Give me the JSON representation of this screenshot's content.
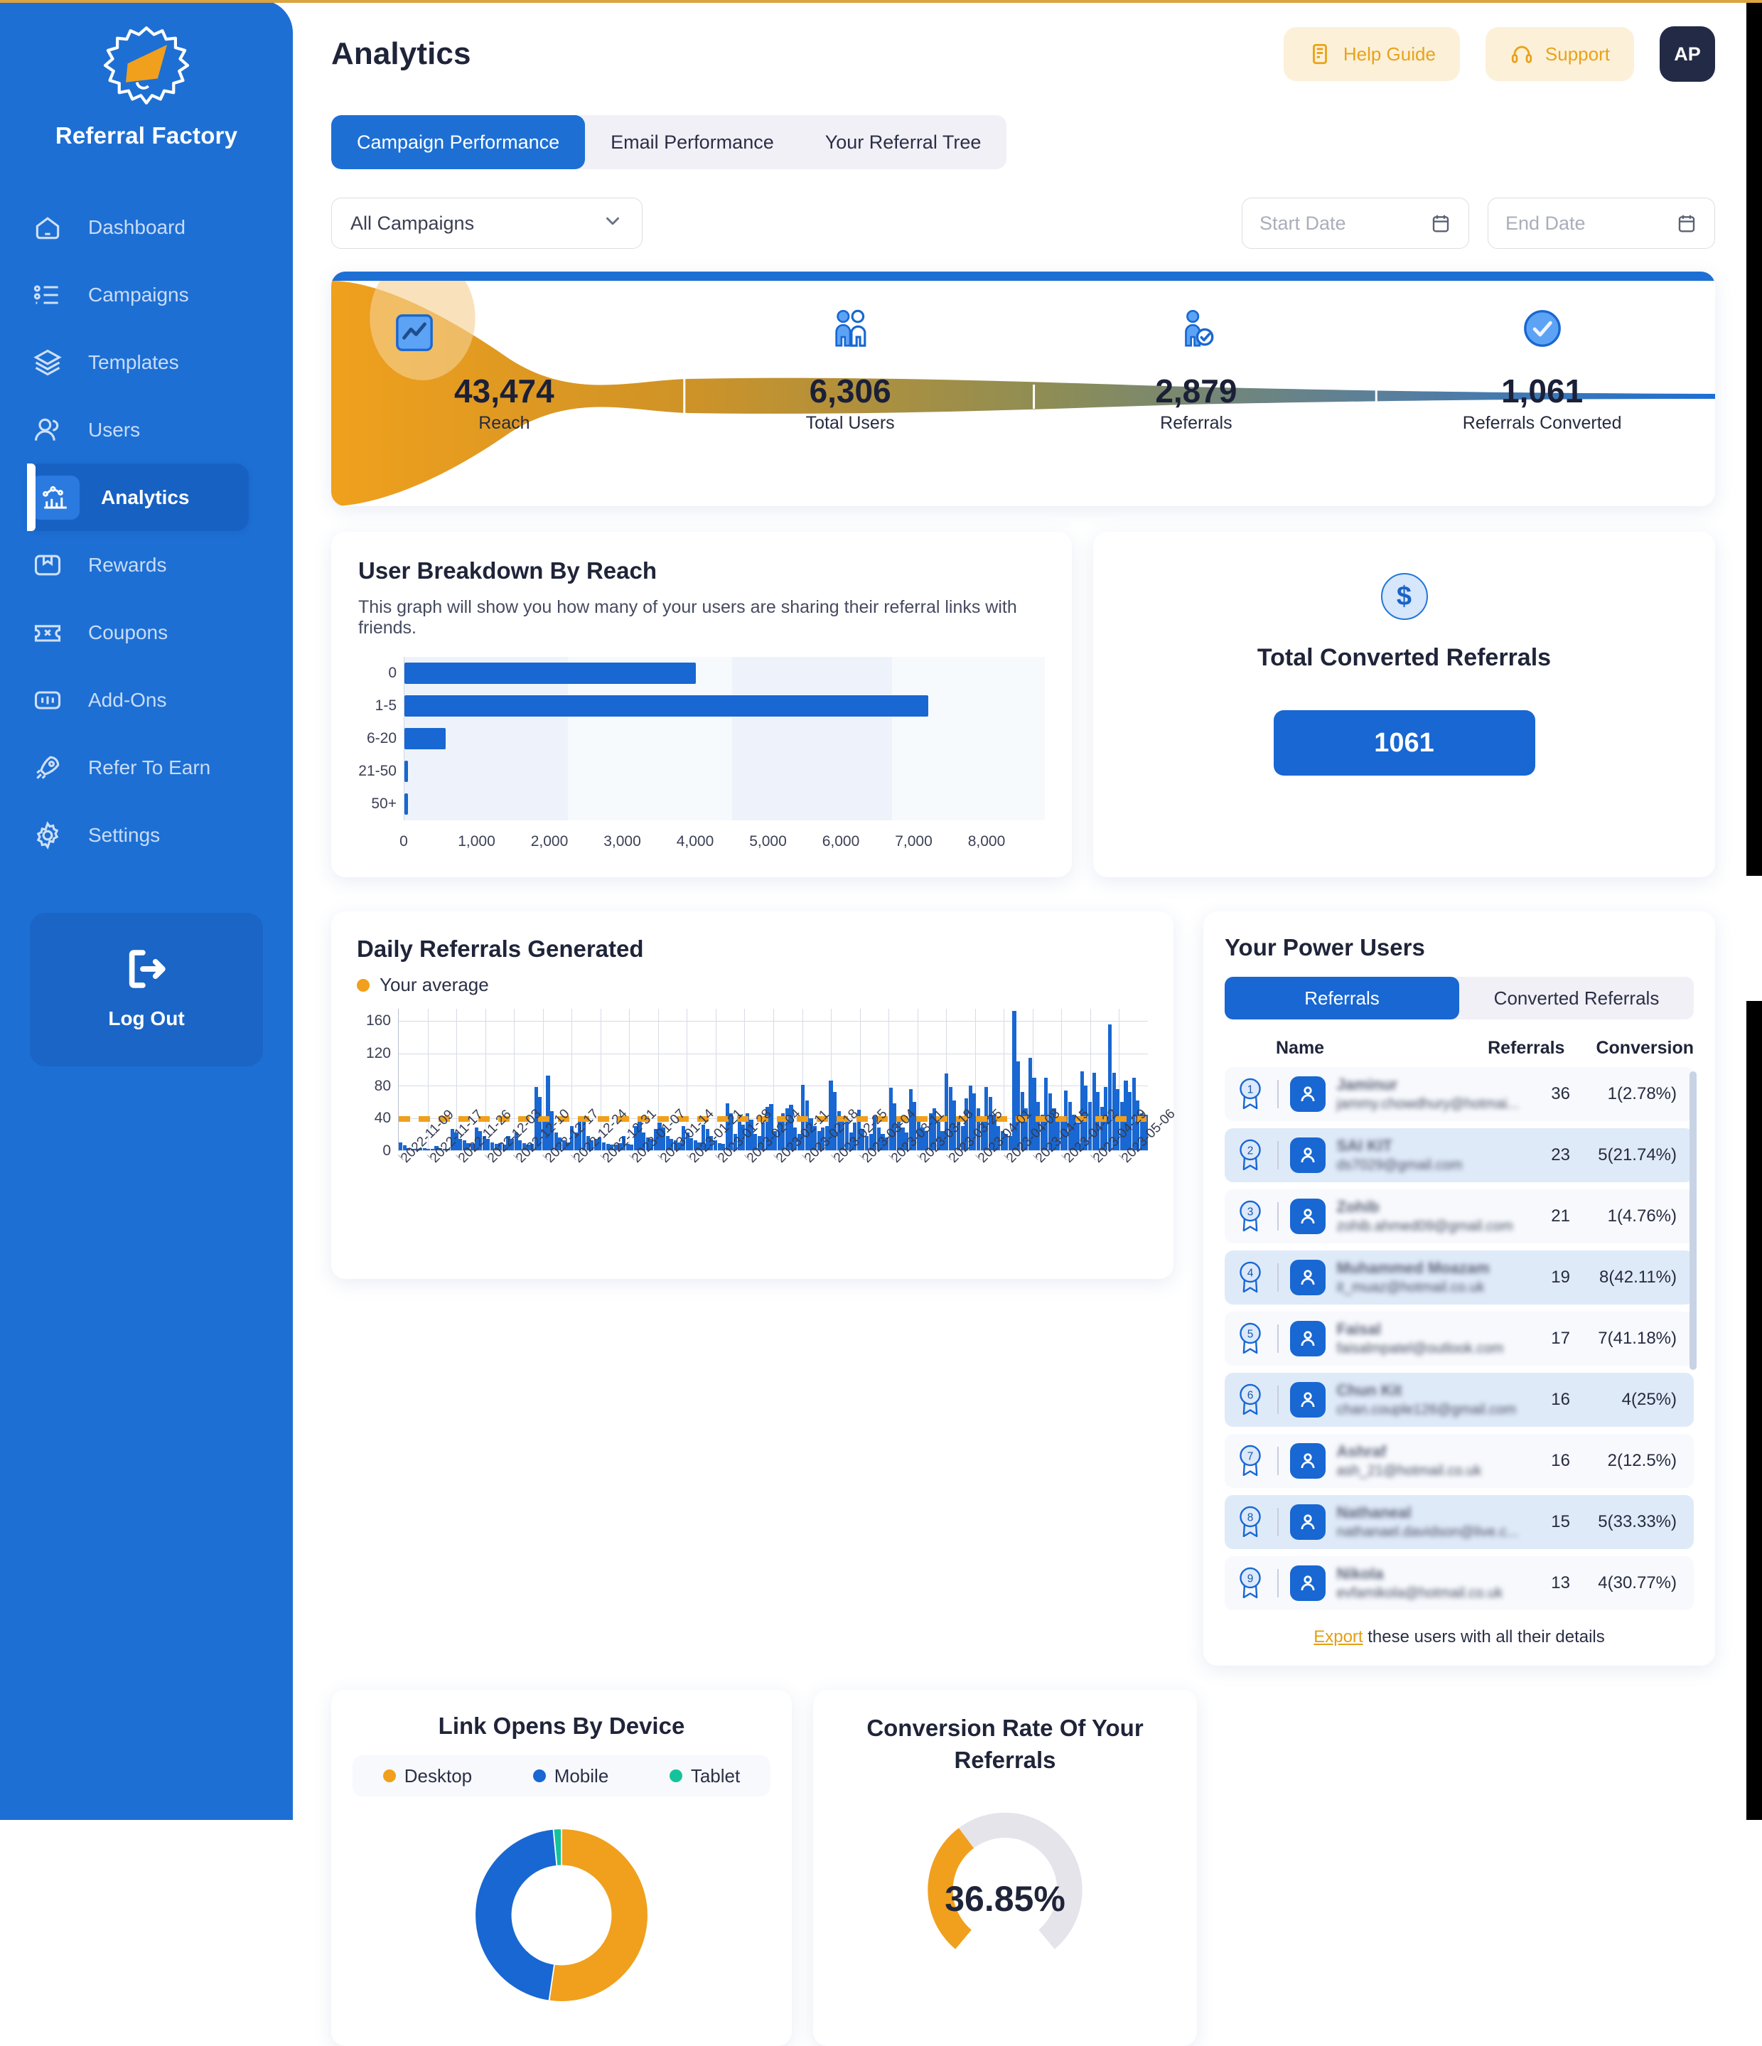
{
  "brand": {
    "name": "Referral Factory"
  },
  "sidebar": {
    "items": [
      {
        "label": "Dashboard",
        "icon": "home-icon",
        "active": false
      },
      {
        "label": "Campaigns",
        "icon": "list-icon",
        "active": false
      },
      {
        "label": "Templates",
        "icon": "layers-icon",
        "active": false
      },
      {
        "label": "Users",
        "icon": "users-icon",
        "active": false
      },
      {
        "label": "Analytics",
        "icon": "analytics-icon",
        "active": true
      },
      {
        "label": "Rewards",
        "icon": "gift-icon",
        "active": false
      },
      {
        "label": "Coupons",
        "icon": "ticket-icon",
        "active": false
      },
      {
        "label": "Add-Ons",
        "icon": "addons-icon",
        "active": false
      },
      {
        "label": "Refer To Earn",
        "icon": "rocket-icon",
        "active": false
      },
      {
        "label": "Settings",
        "icon": "gear-icon",
        "active": false
      }
    ],
    "logout_label": "Log Out"
  },
  "header": {
    "title": "Analytics",
    "help_label": "Help Guide",
    "support_label": "Support",
    "avatar_initials": "AP"
  },
  "tabs": [
    {
      "label": "Campaign Performance",
      "active": true
    },
    {
      "label": "Email Performance",
      "active": false
    },
    {
      "label": "Your Referral Tree",
      "active": false
    }
  ],
  "filters": {
    "campaign_selected": "All Campaigns",
    "start_date_placeholder": "Start Date",
    "end_date_placeholder": "End Date"
  },
  "funnel": {
    "steps": [
      {
        "value": "43,474",
        "label": "Reach",
        "icon": "chart-square-icon"
      },
      {
        "value": "6,306",
        "label": "Total Users",
        "icon": "two-people-icon"
      },
      {
        "value": "2,879",
        "label": "Referrals",
        "icon": "person-check-icon"
      },
      {
        "value": "1,061",
        "label": "Referrals Converted",
        "icon": "check-circle-icon"
      }
    ]
  },
  "breakdown": {
    "title": "User Breakdown By Reach",
    "subtitle": "This graph will show you how many of your users are sharing their referral links with friends."
  },
  "converted": {
    "title": "Total Converted Referrals",
    "value": "1061",
    "icon": "dollar-circle-icon"
  },
  "daily": {
    "title": "Daily Referrals Generated",
    "legend_label": "Your average"
  },
  "power_users": {
    "title": "Your Power Users",
    "tabs": [
      {
        "label": "Referrals",
        "active": true
      },
      {
        "label": "Converted Referrals",
        "active": false
      }
    ],
    "columns": {
      "name": "Name",
      "referrals": "Referrals",
      "conversion": "Conversion"
    },
    "rows": [
      {
        "rank": "1",
        "name": "Jaminur",
        "email": "jammy.chowdhury@hotmai...",
        "referrals": "36",
        "conversion": "1(2.78%)"
      },
      {
        "rank": "2",
        "name": "SAI KIT",
        "email": "ds7029@gmail.com",
        "referrals": "23",
        "conversion": "5(21.74%)"
      },
      {
        "rank": "3",
        "name": "Zohib",
        "email": "zohib.ahmed09@gmail.com",
        "referrals": "21",
        "conversion": "1(4.76%)"
      },
      {
        "rank": "4",
        "name": "Muhammed Moazam",
        "email": "it_muaz@hotmail.co.uk",
        "referrals": "19",
        "conversion": "8(42.11%)"
      },
      {
        "rank": "5",
        "name": "Faisal",
        "email": "faisalmpatel@outlook.com",
        "referrals": "17",
        "conversion": "7(41.18%)"
      },
      {
        "rank": "6",
        "name": "Chun Kit",
        "email": "chan.couple126@gmail.com",
        "referrals": "16",
        "conversion": "4(25%)"
      },
      {
        "rank": "7",
        "name": "Ashraf",
        "email": "ash_21@hotmail.co.uk",
        "referrals": "16",
        "conversion": "2(12.5%)"
      },
      {
        "rank": "8",
        "name": "Nathaneal",
        "email": "nathanael.davidson@live.c...",
        "referrals": "15",
        "conversion": "5(33.33%)"
      },
      {
        "rank": "9",
        "name": "Nikola",
        "email": "evfamikola@hotmail.co.uk",
        "referrals": "13",
        "conversion": "4(30.77%)"
      }
    ],
    "export_link": "Export",
    "export_rest": " these users with all their details"
  },
  "device": {
    "title": "Link Opens By Device",
    "legend": [
      {
        "label": "Desktop",
        "color": "#f0a01d"
      },
      {
        "label": "Mobile",
        "color": "#1867d2"
      },
      {
        "label": "Tablet",
        "color": "#15c39a"
      }
    ]
  },
  "gauge": {
    "title": "Conversion Rate Of Your Referrals",
    "value": "36.85%"
  },
  "colors": {
    "brand_blue": "#1d6fd4",
    "accent_orange": "#f0a01d",
    "dark_navy": "#1f2439",
    "teal": "#15c39a"
  },
  "chart_data": [
    {
      "type": "bar",
      "title": "User Breakdown By Reach",
      "orientation": "horizontal",
      "categories": [
        "0",
        "1-5",
        "6-20",
        "21-50",
        "50+"
      ],
      "values": [
        4000,
        7200,
        570,
        50,
        10
      ],
      "xlabel": "",
      "ylabel": "",
      "xlim": [
        0,
        8800
      ],
      "xticks": [
        "0",
        "1,000",
        "2,000",
        "3,000",
        "4,000",
        "5,000",
        "6,000",
        "7,000",
        "8,000"
      ],
      "grid": true,
      "legend": "none",
      "series_color": "#1867d2"
    },
    {
      "type": "bar",
      "title": "Daily Referrals Generated",
      "xlabel": "",
      "ylabel": "",
      "ylim": [
        0,
        175
      ],
      "yticks": [
        0,
        40,
        80,
        120,
        160
      ],
      "grid": true,
      "legend": [
        "Your average"
      ],
      "average_line": 35,
      "xticks": [
        "2022-11-09",
        "2022-11-17",
        "2022-11-26",
        "2022-12-03",
        "2022-12-10",
        "2022-12-17",
        "2022-12-24",
        "2022-12-31",
        "2023-01-07",
        "2023-01-14",
        "2023-01-21",
        "2023-01-28",
        "2023-02-04",
        "2023-02-11",
        "2023-02-18",
        "2023-02-25",
        "2023-03-04",
        "2023-03-11",
        "2023-03-18",
        "2023-03-25",
        "2023-04-01",
        "2023-04-08",
        "2023-04-15",
        "2023-04-22",
        "2023-04-29",
        "2023-05-06"
      ],
      "values": [
        10,
        6,
        3,
        2,
        2,
        3,
        3,
        2,
        2,
        5,
        3,
        2,
        2,
        26,
        22,
        14,
        12,
        9,
        8,
        28,
        24,
        18,
        14,
        10,
        8,
        9,
        7,
        18,
        14,
        22,
        12,
        9,
        7,
        8,
        78,
        66,
        40,
        92,
        48,
        22,
        16,
        12,
        10,
        30,
        22,
        42,
        36,
        18,
        12,
        14,
        16,
        10,
        8,
        7,
        7,
        9,
        18,
        8,
        7,
        30,
        38,
        22,
        16,
        14,
        26,
        34,
        28,
        18,
        14,
        12,
        10,
        30,
        22,
        15,
        12,
        10,
        32,
        26,
        18,
        12,
        9,
        8,
        58,
        46,
        20,
        44,
        32,
        46,
        38,
        20,
        18,
        34,
        54,
        57,
        24,
        36,
        46,
        52,
        56,
        28,
        20,
        81,
        62,
        40,
        30,
        24,
        28,
        30,
        86,
        72,
        48,
        42,
        36,
        22,
        34,
        50,
        26,
        18,
        20,
        42,
        28,
        20,
        16,
        77,
        58,
        40,
        28,
        22,
        76,
        60,
        38,
        28,
        24,
        46,
        52,
        36,
        24,
        95,
        78,
        62,
        42,
        30,
        64,
        80,
        70,
        52,
        36,
        78,
        66,
        44,
        30,
        24,
        20,
        18,
        172,
        110,
        72,
        52,
        114,
        90,
        60,
        44,
        90,
        70,
        52,
        38,
        36,
        74,
        60,
        44,
        34,
        98,
        80,
        60,
        96,
        72,
        54,
        78,
        156,
        96,
        76,
        60,
        86,
        72,
        90,
        62,
        46,
        44
      ],
      "series_color": "#1867d2"
    },
    {
      "type": "pie",
      "title": "Link Opens By Device",
      "labels": [
        "Desktop",
        "Mobile",
        "Tablet"
      ],
      "values": [
        52.3,
        46.2,
        1.5
      ],
      "colors": [
        "#f0a01d",
        "#1867d2",
        "#15c39a"
      ],
      "legend": "top",
      "donut": true
    },
    {
      "type": "pie",
      "title": "Conversion Rate Of Your Referrals",
      "labels": [
        "Converted",
        "Remaining"
      ],
      "values": [
        36.85,
        63.15
      ],
      "colors": [
        "#f0a01d",
        "#e4e4ea"
      ],
      "donut": true,
      "gauge": true,
      "center_label": "36.85%"
    }
  ]
}
